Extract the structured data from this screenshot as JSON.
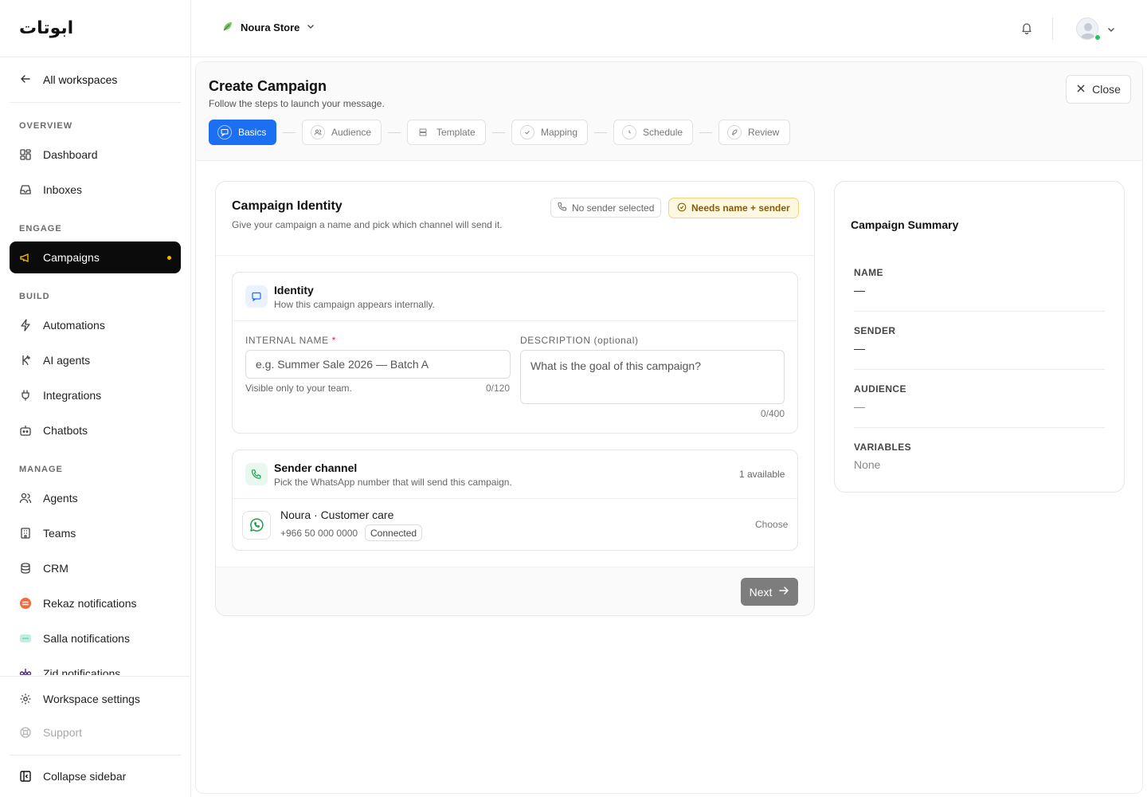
{
  "brand": {
    "logo_text": "ابوتات"
  },
  "sidebar": {
    "back_label": "All workspaces",
    "sections": {
      "overview": "OVERVIEW",
      "engage": "ENGAGE",
      "build": "BUILD",
      "manage": "MANAGE"
    },
    "items": {
      "dashboard": "Dashboard",
      "inboxes": "Inboxes",
      "campaigns": "Campaigns",
      "automations": "Automations",
      "ai_agents": "AI agents",
      "integrations": "Integrations",
      "chatbots": "Chatbots",
      "agents": "Agents",
      "teams": "Teams",
      "crm": "CRM",
      "rekaz": "Rekaz notifications",
      "salla": "Salla notifications",
      "zid": "Zid notifications"
    },
    "bottom": {
      "workspace_settings": "Workspace settings",
      "support": "Support",
      "collapse": "Collapse sidebar"
    },
    "colors": {
      "active_bg": "#0b0b0b",
      "active_dot": "#f5b400"
    }
  },
  "topbar": {
    "store_name": "Noura Store",
    "store_icon": "leaf-icon",
    "notifications_icon": "bell-icon",
    "presence": "online"
  },
  "page": {
    "title": "Create Campaign",
    "subtitle": "Follow the steps to launch your message.",
    "close_label": "Close",
    "steps": [
      {
        "label": "Basics",
        "active": true
      },
      {
        "label": "Audience",
        "active": false
      },
      {
        "label": "Template",
        "active": false
      },
      {
        "label": "Mapping",
        "active": false
      },
      {
        "label": "Schedule",
        "active": false
      },
      {
        "label": "Review",
        "active": false
      }
    ],
    "accent": "#1d6ff2"
  },
  "identity_card": {
    "title": "Campaign Identity",
    "subtitle": "Give your campaign a name and pick which channel will send it.",
    "sender_pill": "No sender selected",
    "warning_pill": "Needs name + sender",
    "identity": {
      "title": "Identity",
      "desc": "How this campaign appears internally.",
      "name_label": "INTERNAL NAME",
      "name_required_mark": "*",
      "name_placeholder": "e.g. Summer Sale 2026 — Batch A",
      "name_value": "",
      "name_helper": "Visible only to your team.",
      "name_counter": "0/120",
      "desc_label": "DESCRIPTION (optional)",
      "desc_placeholder": "What is the goal of this campaign?",
      "desc_value": "",
      "desc_counter": "0/400"
    },
    "sender": {
      "title": "Sender channel",
      "desc": "Pick the WhatsApp number that will send this campaign.",
      "available": "1 available",
      "option_name": "Noura · Customer care",
      "option_phone": "+966 50 000 0000",
      "option_status": "Connected",
      "choose_label": "Choose"
    },
    "next_label": "Next"
  },
  "summary": {
    "title": "Campaign Summary",
    "rows": [
      {
        "label": "NAME",
        "value": "—"
      },
      {
        "label": "SENDER",
        "value": "—"
      },
      {
        "label": "AUDIENCE",
        "value": "—"
      },
      {
        "label": "VARIABLES",
        "value": "None"
      }
    ]
  }
}
